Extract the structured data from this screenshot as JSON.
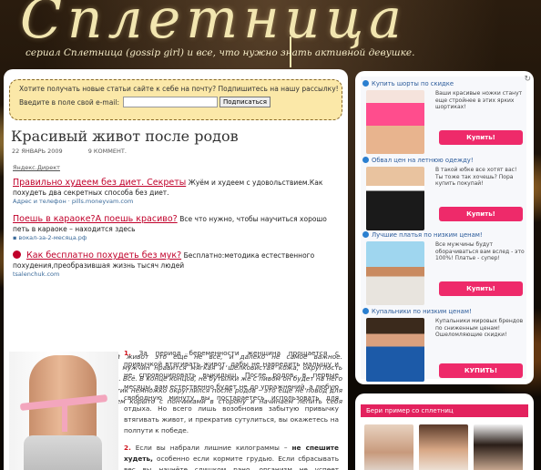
{
  "site": {
    "logo": "Сплетница",
    "tagline": "сериал Сплетница (gossip girl) и все, что нужно знать активной девушке."
  },
  "subscribe": {
    "prompt": "Хотите получать новые статьи сайте к себе на почту? Подпишитесь на нашу рассылку!",
    "email_label": "Введите в поле свой e-mail:",
    "email_value": "",
    "button_label": "Подписаться"
  },
  "post": {
    "title": "Красивый живот после родов",
    "date": "22 ЯНВАРЬ 2009",
    "comments": "9 КОММЕНТ."
  },
  "ads": {
    "label": "Яндекс.Директ",
    "items": [
      {
        "link": "Правильно худеем без диет. Секреты",
        "text": "Жуём и худеем с удовольствием.Как похудеть два секретных способа без диет.",
        "url": "Адрес и телефон · pills.moneyvam.com"
      },
      {
        "link": "Поешь в караоке?А поешь красиво?",
        "text": "Все что нужно, чтобы научиться хорошо петь в караоке – находится здесь",
        "url": "вокал-за-2-месяца.рф"
      },
      {
        "link": "Как бесплатно похудеть без мук?",
        "text": "Бесплатно:методика естественного похудения,преобразившая жизнь тысяч людей",
        "url": "tsalenchuk.com"
      }
    ]
  },
  "article": {
    "intro": "Начну с главного: плоский живот это ещё не всё, и далеко не самое важное. Подавляющему большинству мужчин нравится мягкая и шелковистая кожа, округлость форм и отсутствие дряблости. Всё. В конце концов, не бутылки же с пивом он будет на него ставить. Поэтому, если животик немножко округлился после родов – это ещё не повод для крупных выстрел. Отодвигаем корыто с пончиками в сторону и начинаем лепить себя любимую.",
    "p1_num": "1.",
    "p1": "За период беременности женщина прощается с привычкой втягивать живот, дабы не навредить малышу и не спровоцировать выкидыш. После родов, в первые месяцы, вам естественно будет не до упражнений, а любую свободную минуту вы постараетесь использовать для отдыха. Но всего лишь возобновив забытую привычку втягивать живот, и прекратив сутулиться, вы окажетесь на полпути к победе.",
    "p2_num": "2.",
    "p2_start": "Если вы набрали лишние килограммы –",
    "p2_bold": "не спешите худеть,",
    "p2_rest": "особенно если кормите грудью. Если сбрасывать вес вы начнёте слишком рано, организм не успеет восстановиться, а кожный покров на"
  },
  "shop": {
    "items": [
      {
        "title": "Купить шорты по скидке",
        "desc": "Ваши красивые ножки станут еще стройнее в этих ярких шортиках!",
        "button": "Купить!"
      },
      {
        "title": "Обвал цен на летнюю одежду!",
        "desc": "В такой юбке все хотят вас! Ты тоже так хочешь? Пора купить покупай!",
        "button": "Купить!"
      },
      {
        "title": "Лучшие платья по низким ценам!",
        "desc": "Все мужчины будут оборачиваться вам вслед - это 100%! Платье - супер!",
        "button": "Купить!"
      },
      {
        "title": "Купальники по низким ценам!",
        "desc": "Купальники мировых брендов по сниженным ценам! Ошеломляющие скидки!",
        "button": "КУПИТЬ!"
      }
    ]
  },
  "examples": {
    "title": "Бери пример со сплетниц"
  },
  "colors": {
    "accent": "#ee2a6a",
    "ad_link": "#c0002a",
    "subscribe_bg": "#fbe8a8"
  }
}
